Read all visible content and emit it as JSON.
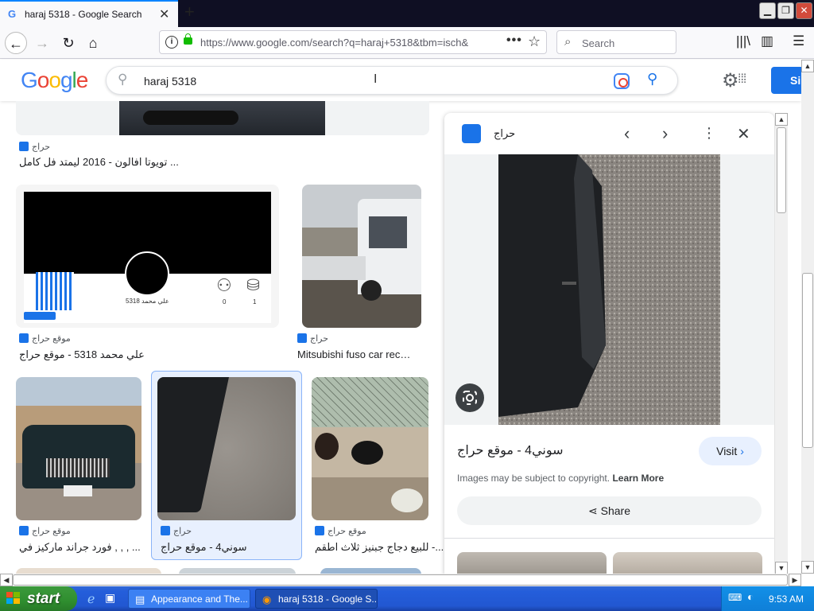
{
  "browser": {
    "tab_title": "haraj 5318 - Google Search",
    "url": "https://www.google.com/search?q=haraj+5318&tbm=isch&",
    "search_placeholder": "Search"
  },
  "google": {
    "query": "haraj 5318",
    "signin_label": "Si"
  },
  "results": [
    {
      "source": "حراج",
      "title": "تويوتا افالون - 2016 ليمتد فل كامل ..."
    },
    {
      "source": "موقع حراج",
      "title": "علي محمد 5318 - موقع حراج",
      "profile_name": "علي محمد 5318",
      "stat1": "0",
      "stat2": "1"
    },
    {
      "source": "حراج",
      "title": "Mitsubishi fuso car rec…"
    },
    {
      "source": "موقع حراج",
      "title": "فورد جراند ماركيز في ,  ,  ,  ..."
    },
    {
      "source": "حراج",
      "title": "سوني4 - موقع حراج"
    },
    {
      "source": "موقع حراج",
      "title": "للبيع دجاج جبنيز ثلاث اطقم -..."
    }
  ],
  "panel": {
    "source": "حراج",
    "title": "سوني4 - موقع حراج",
    "visit_label": "Visit",
    "copyright_text": "Images may be subject to copyright.",
    "learn_more": "Learn More",
    "share_label": "Share"
  },
  "taskbar": {
    "start_label": "start",
    "task1": "Appearance and The...",
    "task2": "haraj 5318 - Google S...",
    "clock": "9:53 AM"
  }
}
